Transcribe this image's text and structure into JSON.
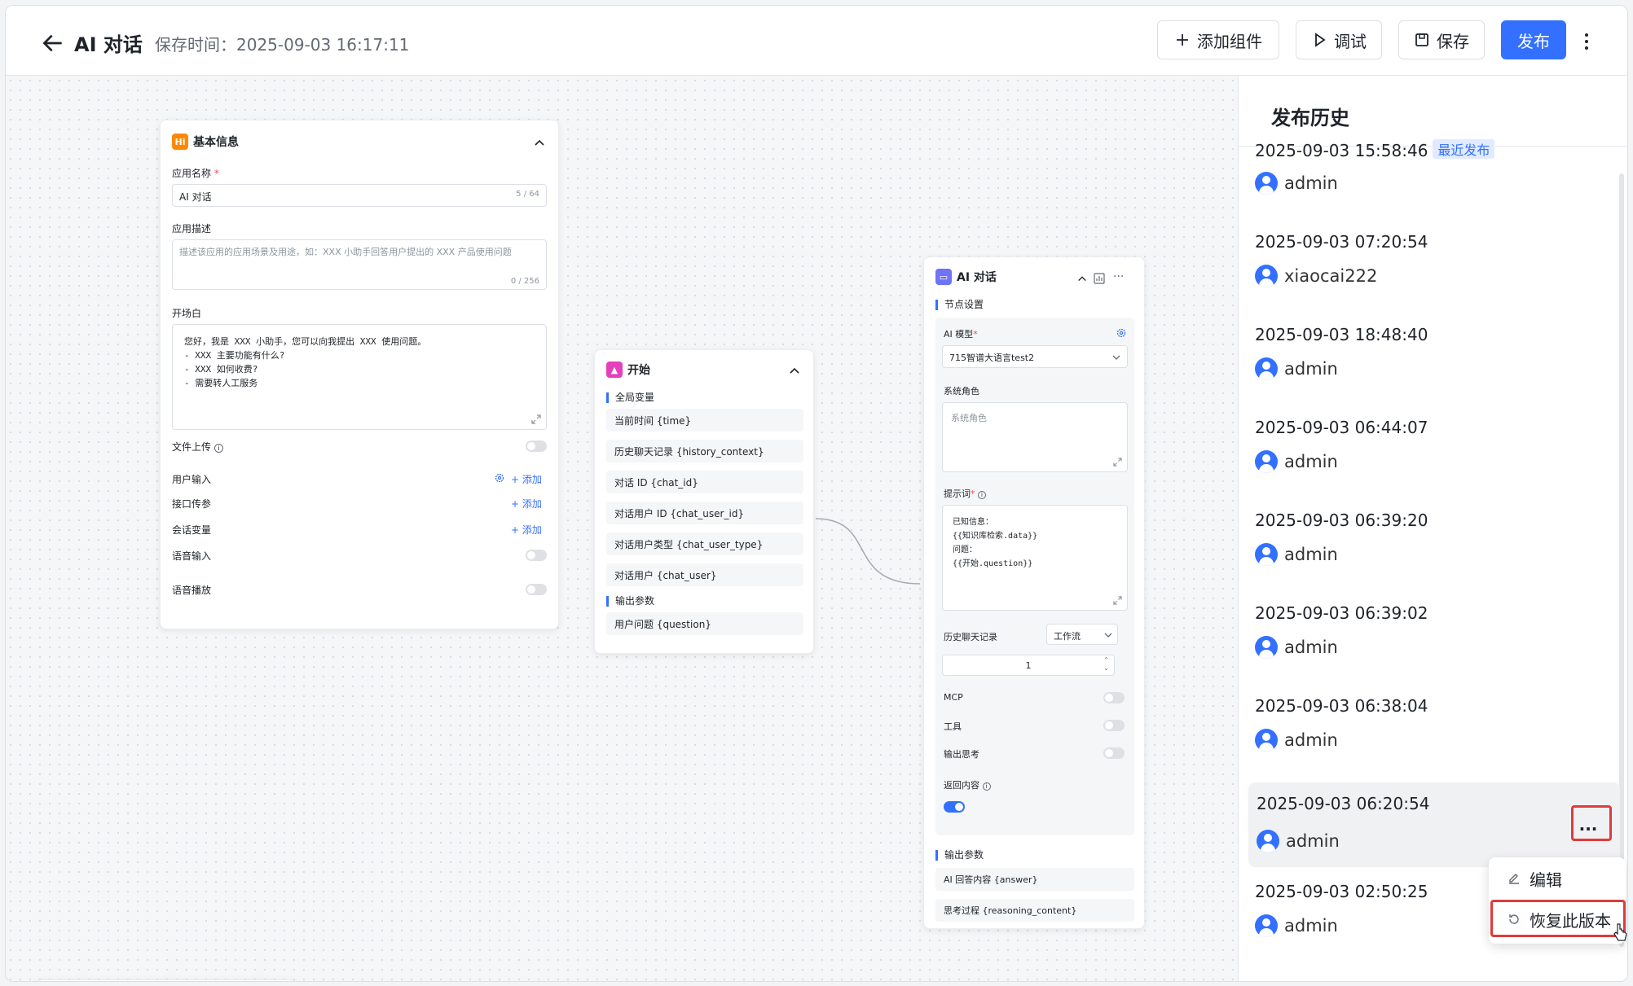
{
  "header": {
    "title": "AI 对话",
    "save_time": "保存时间：2025-09-03 16:17:11",
    "buttons": {
      "add_component": "添加组件",
      "debug": "调试",
      "save": "保存",
      "publish": "发布"
    }
  },
  "basic_info": {
    "title": "基本信息",
    "app_name_label": "应用名称",
    "app_name_value": "AI 对话",
    "app_name_count": "5 / 64",
    "desc_label": "应用描述",
    "desc_placeholder": "描述该应用的应用场景及用途，如：XXX 小助手回答用户提出的 XXX 产品使用问题",
    "desc_count": "0 / 256",
    "opening_label": "开场白",
    "opening_lines": [
      "您好，我是 XXX 小助手，您可以向我提出 XXX 使用问题。",
      "- XXX 主要功能有什么?",
      "- XXX 如何收费?",
      "- 需要转人工服务"
    ],
    "file_upload": "文件上传",
    "user_input": "用户输入",
    "api_params": "接口传参",
    "session_vars": "会话变量",
    "voice_input": "语音输入",
    "voice_play": "语音播放",
    "add": "添加"
  },
  "start_node": {
    "title": "开始",
    "global_vars": "全局变量",
    "vars": [
      "当前时间 {time}",
      "历史聊天记录 {history_context}",
      "对话 ID {chat_id}",
      "对话用户 ID {chat_user_id}",
      "对话用户类型 {chat_user_type}",
      "对话用户 {chat_user}"
    ],
    "output_params": "输出参数",
    "outputs": [
      "用户问题 {question}"
    ]
  },
  "ai_node": {
    "title": "AI 对话",
    "node_settings": "节点设置",
    "model_label": "AI 模型",
    "model_value": "715智谱大语言test2",
    "system_role_label": "系统角色",
    "system_role_placeholder": "系统角色",
    "prompt_label": "提示词",
    "prompt_lines": [
      "已知信息：",
      "{{知识库检索.data}}",
      "问题：",
      "{{开始.question}}"
    ],
    "history_label": "历史聊天记录",
    "history_mode": "工作流",
    "history_count": "1",
    "mcp": "MCP",
    "tools": "工具",
    "output_thinking": "输出思考",
    "return_content": "返回内容",
    "output_params": "输出参数",
    "outputs": [
      "AI 回答内容 {answer}",
      "思考过程 {reasoning_content}"
    ]
  },
  "publish_history": {
    "title": "发布历史",
    "latest_badge": "最近发布",
    "items": [
      {
        "time": "2025-09-03 15:58:46",
        "user": "admin"
      },
      {
        "time": "2025-09-03 07:20:54",
        "user": "xiaocai222"
      },
      {
        "time": "2025-09-03 18:48:40",
        "user": "admin"
      },
      {
        "time": "2025-09-03 06:44:07",
        "user": "admin"
      },
      {
        "time": "2025-09-03 06:39:20",
        "user": "admin"
      },
      {
        "time": "2025-09-03 06:39:02",
        "user": "admin"
      },
      {
        "time": "2025-09-03 06:38:04",
        "user": "admin"
      },
      {
        "time": "2025-09-03 06:20:54",
        "user": "admin"
      },
      {
        "time": "2025-09-03 02:50:25",
        "user": "admin"
      }
    ],
    "menu": {
      "edit": "编辑",
      "restore": "恢复此版本"
    }
  }
}
